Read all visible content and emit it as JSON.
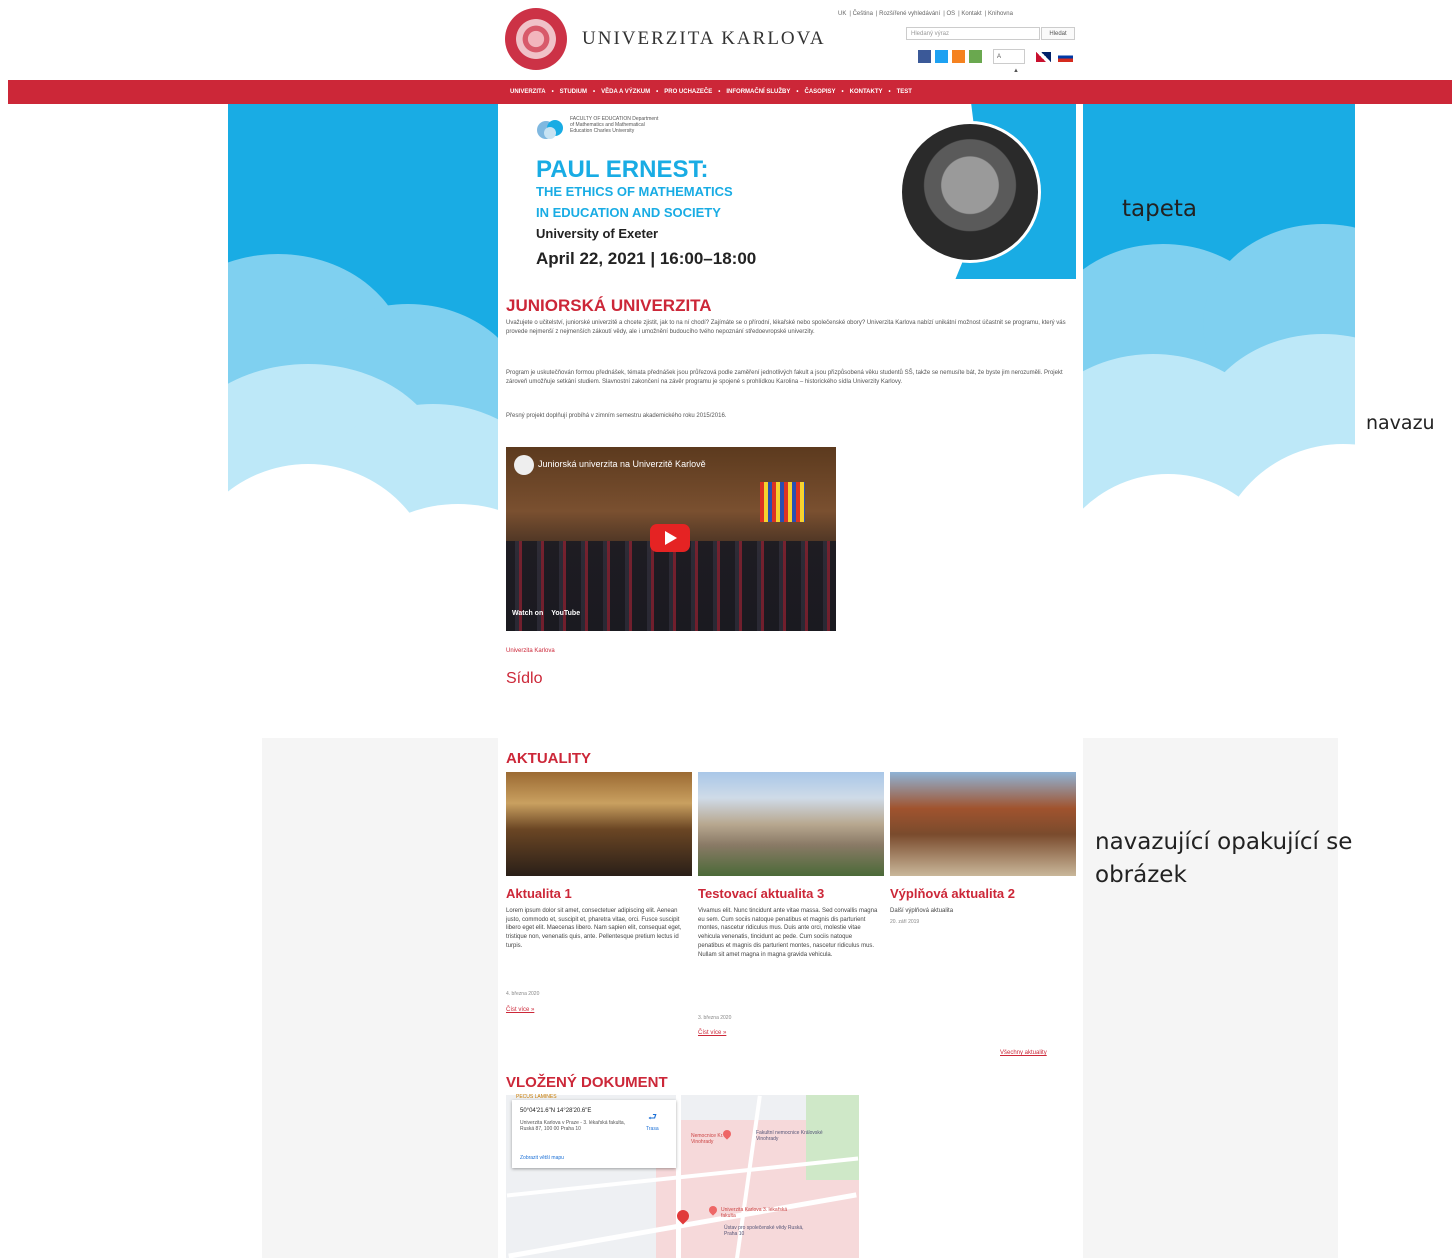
{
  "header": {
    "brand": "UNIVERZITA KARLOVA",
    "top_links": [
      "UK",
      "Čeština",
      "Rozšířené vyhledávání",
      "OS",
      "Kontakt",
      "Knihovna"
    ],
    "search_placeholder": "Hledaný výraz",
    "search_button": "Hledat",
    "font_select": "A",
    "social_colors": [
      "#3b5998",
      "#1da1f2",
      "#f58220",
      "#6aa84f"
    ]
  },
  "nav": {
    "items": [
      "UNIVERZITA",
      "STUDIUM",
      "VĚDA A VÝZKUM",
      "PRO UCHAZEČE",
      "INFORMAČNÍ SLUŽBY",
      "ČASOPISY",
      "KONTAKTY",
      "TEST"
    ]
  },
  "banner": {
    "logo_text": "FACULTY OF EDUCATION Department of Mathematics and Mathematical Education Charles University",
    "title": "PAUL ERNEST:",
    "subtitle_1": "THE ETHICS OF MATHEMATICS",
    "subtitle_2": "IN EDUCATION AND SOCIETY",
    "university": "University of Exeter",
    "date": "April 22, 2021 | 16:00–18:00"
  },
  "junior": {
    "heading": "JUNIORSKÁ UNIVERZITA",
    "p1": "Uvažujete o učitelství, juniorské univerzitě a chcete zjistit, jak to na ní chodí? Zajímáte se o přírodní, lékařské nebo společenské obory? Univerzita Karlova nabízí unikátní možnost účastnit se programu, který vás provede nejmenší z nejmenších zákoutí vědy, ale i umožnění budoucího tvého nepoznání středoevropské univerzity.",
    "p2": "Program je uskutečňován formou přednášek, témata přednášek jsou průřezová podle zaměření jednotlivých fakult a jsou přizpůsobená věku studentů SŠ, takže se nemusíte bát, že byste jim nerozuměli. Projekt zároveň umožňuje setkání studiem. Slavnostní zakončení na závěr programu je spojené s prohlídkou Karolina – historického sídla Univerzity Karlovy.",
    "p3": "Přesný projekt doplňují probíhá v zimním semestru akademického roku 2015/2016."
  },
  "video": {
    "title": "Juniorská univerzita na Univerzitě Karlově",
    "watch_on": "Watch on",
    "youtube": "YouTube"
  },
  "location": {
    "small_link": "Univerzita Karlova",
    "title": "Sídlo"
  },
  "news": {
    "heading": "AKTUALITY",
    "items": [
      {
        "title": "Aktualita 1",
        "text": "Lorem ipsum dolor sit amet, consectetuer adipiscing elit. Aenean justo, commodo et, suscipit et, pharetra vitae, orci. Fusce suscipit libero eget elit. Maecenas libero. Nam sapien elit, consequat eget, tristique non, venenatis quis, ante. Pellentesque pretium lectus id turpis.",
        "date": "4. března 2020",
        "more": "Číst více »",
        "colors": [
          "#8a5a2a",
          "#c9a060",
          "#3a2818"
        ]
      },
      {
        "title": "Testovací aktualita 3",
        "text": "Vivamus elit. Nunc tincidunt ante vitae massa. Sed convallis magna eu sem. Cum sociis natoque penatibus et magnis dis parturient montes, nascetur ridiculus mus. Duis ante orci, molestie vitae vehicula venenatis, tincidunt ac pede. Cum sociis natoque penatibus et magnis dis parturient montes, nascetur ridiculus mus. Nullam sit amet magna in magna gravida vehicula.",
        "date": "3. března 2020",
        "more": "Číst více »",
        "colors": [
          "#a9c7e8",
          "#b8a890",
          "#4b6a38"
        ]
      },
      {
        "title": "Výplňová aktualita 2",
        "text": "Další výplňová aktualita",
        "date": "20. září 2019",
        "more": "",
        "colors": [
          "#8fb3d6",
          "#a0532e",
          "#c9b79a"
        ]
      }
    ],
    "all": "Všechny aktuality"
  },
  "document": {
    "heading": "VLOŽENÝ DOKUMENT",
    "card_top": "PECUS LAMINES",
    "coords": "50°04'21.6\"N 14°28'20.6\"E",
    "address": "Univerzita Karlova v Praze - 3. lékařská fakulta, Ruská 87, 100 00 Praha 10",
    "directions": "Trasa",
    "map_link": "Zobrazit větší mapu",
    "map_place_1": "Nemocnice Kr. Vinohrady",
    "map_place_2": "Fakultní nemocnice Královské Vinohrady",
    "map_place_3": "Univerzita Karlova 3. lékařská fakulta",
    "map_place_4": "Ústav pro společenské vědy Ruská, Praha 10"
  },
  "annotations": {
    "wallpaper": "tapeta",
    "right_cut": "navazu",
    "repeat": "navazující opakující se obrázek"
  }
}
